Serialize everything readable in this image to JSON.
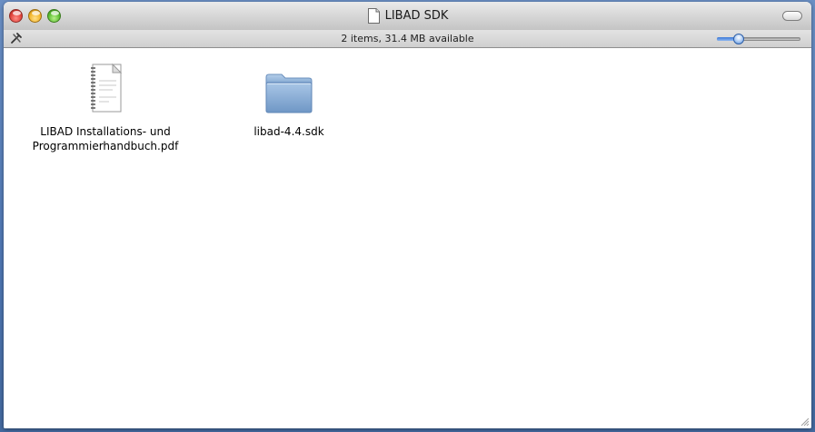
{
  "window": {
    "title": "LIBAD SDK",
    "status_text": "2 items, 31.4 MB available"
  },
  "icons": {
    "window_proxy": "document-icon",
    "toolbar_left": "tools-icon",
    "toggle": "toolbar-toggle-icon"
  },
  "items": [
    {
      "kind": "pdf-document",
      "label_line1": "LIBAD Installations- und",
      "label_line2": "Programmierhandbuch.pdf"
    },
    {
      "kind": "folder",
      "label_line1": "libad-4.4.sdk",
      "label_line2": ""
    }
  ],
  "icon_size_slider": {
    "value_fraction": 0.22
  },
  "colors": {
    "desktop": "#5a80bb",
    "folder": "#8fb3da",
    "close": "#e0413a",
    "minimize": "#f3b52a",
    "zoom": "#5cbf33"
  }
}
